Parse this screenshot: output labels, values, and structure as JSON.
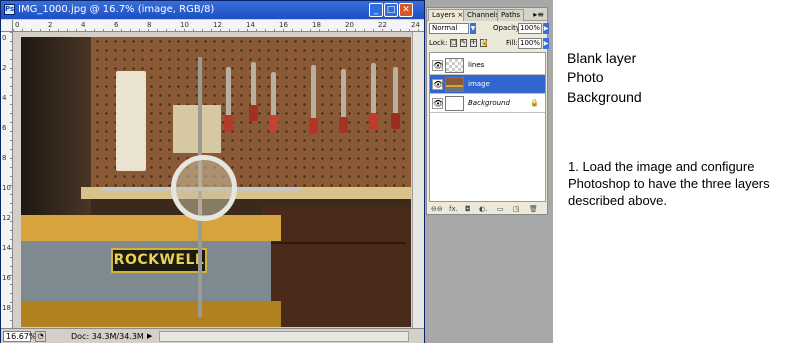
{
  "document": {
    "title": "IMG_1000.jpg @ 16.7% (image, RGB/8)",
    "app_icon": "Ps",
    "window_buttons": {
      "minimize": "_",
      "maximize": "□",
      "close": "✕"
    },
    "ruler_top_ticks": [
      "0",
      "2",
      "4",
      "6",
      "8",
      "10",
      "12",
      "14",
      "16",
      "18",
      "20",
      "22",
      "24"
    ],
    "ruler_left_ticks": [
      "0",
      "2",
      "4",
      "6",
      "8",
      "10",
      "12",
      "14",
      "16",
      "18"
    ],
    "photo_label": "ROCKWELL",
    "status": {
      "zoom": "16.67%",
      "doc_size": "Doc: 34.3M/34.3M",
      "arrow": "▶"
    }
  },
  "layers_panel": {
    "tabs": [
      "Layers",
      "Channels",
      "Paths"
    ],
    "tab_close": "×",
    "menu": "▸≡",
    "blend_mode": "Normal",
    "opacity_label": "Opacity:",
    "opacity_value": "100%",
    "lock_label": "Lock:",
    "lock_icons": [
      "▢",
      "✎",
      "✛",
      "🔒"
    ],
    "fill_label": "Fill:",
    "fill_value": "100%",
    "layers": [
      {
        "name": "lines",
        "visible": true,
        "selected": false,
        "thumb": "transparent",
        "italic": false
      },
      {
        "name": "image",
        "visible": true,
        "selected": true,
        "thumb": "photo",
        "italic": false
      },
      {
        "name": "Background",
        "visible": true,
        "selected": false,
        "thumb": "white",
        "italic": true,
        "locked": true
      }
    ],
    "bottom_icons": [
      "link-icon",
      "fx-icon",
      "mask-icon",
      "adjustment-icon",
      "group-icon",
      "new-layer-icon",
      "trash-icon"
    ],
    "bottom_glyphs": [
      "⊖⊖",
      "fx.",
      "◘",
      "◐.",
      "▭",
      "◳",
      "🗑"
    ],
    "visibility_glyph": "👁",
    "lock_glyph": "🔒"
  },
  "side_labels": [
    "Blank layer",
    "Photo",
    "Background"
  ],
  "instructions": "1. Load the image and configure Photoshop to have the three layers described above.",
  "colors": {
    "titlebar": "#1c4fc4",
    "selected_layer": "#3366cc",
    "workspace": "#a8a8a8"
  }
}
